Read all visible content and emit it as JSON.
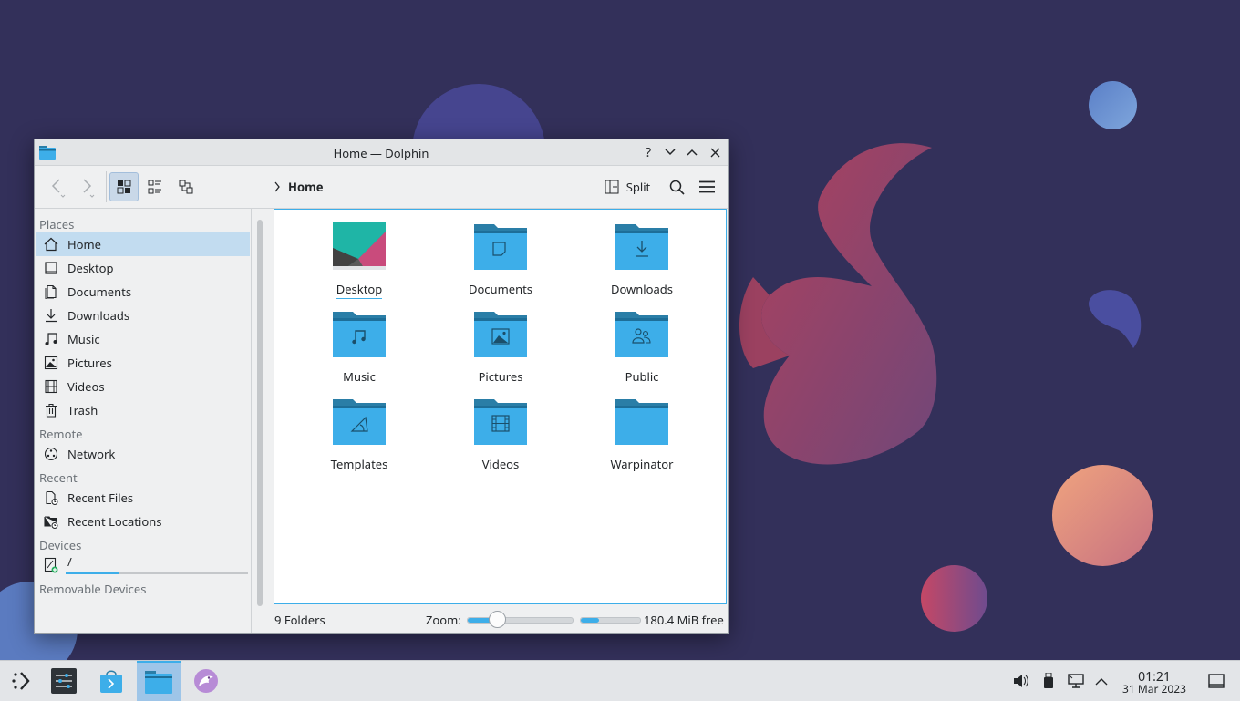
{
  "window": {
    "title": "Home — Dolphin",
    "help_label": "?",
    "breadcrumb": "Home",
    "split_label": "Split"
  },
  "sidebar": {
    "sections": [
      {
        "title": "Places",
        "items": [
          {
            "label": "Home",
            "icon": "home-icon",
            "selected": true
          },
          {
            "label": "Desktop",
            "icon": "desktop-icon"
          },
          {
            "label": "Documents",
            "icon": "documents-icon"
          },
          {
            "label": "Downloads",
            "icon": "downloads-icon"
          },
          {
            "label": "Music",
            "icon": "music-icon"
          },
          {
            "label": "Pictures",
            "icon": "pictures-icon"
          },
          {
            "label": "Videos",
            "icon": "videos-icon"
          },
          {
            "label": "Trash",
            "icon": "trash-icon"
          }
        ]
      },
      {
        "title": "Remote",
        "items": [
          {
            "label": "Network",
            "icon": "network-icon"
          }
        ]
      },
      {
        "title": "Recent",
        "items": [
          {
            "label": "Recent Files",
            "icon": "recent-files-icon"
          },
          {
            "label": "Recent Locations",
            "icon": "recent-locations-icon"
          }
        ]
      },
      {
        "title": "Devices",
        "items": [
          {
            "label": "/",
            "icon": "drive-icon",
            "usage_fraction": 0.29
          }
        ]
      },
      {
        "title": "Removable Devices",
        "items": []
      }
    ]
  },
  "folders": [
    {
      "name": "Desktop",
      "icon": "desktop-thumbnail"
    },
    {
      "name": "Documents",
      "icon": "document-folder-icon"
    },
    {
      "name": "Downloads",
      "icon": "download-folder-icon"
    },
    {
      "name": "Music",
      "icon": "music-folder-icon"
    },
    {
      "name": "Pictures",
      "icon": "pictures-folder-icon"
    },
    {
      "name": "Public",
      "icon": "public-folder-icon"
    },
    {
      "name": "Templates",
      "icon": "templates-folder-icon"
    },
    {
      "name": "Videos",
      "icon": "videos-folder-icon"
    },
    {
      "name": "Warpinator",
      "icon": "folder-icon"
    }
  ],
  "status": {
    "count": "9 Folders",
    "zoom_label": "Zoom:",
    "zoom_fraction": 0.28,
    "free_label": "180.4 MiB free",
    "space_used_fraction": 0.3
  },
  "taskbar": {
    "time": "01:21",
    "date": "31 Mar 2023"
  },
  "colors": {
    "accent": "#3daee9",
    "folder": "#3daee9",
    "folder_tab": "#2a7ea7",
    "desktop_bg": "#33305a"
  }
}
